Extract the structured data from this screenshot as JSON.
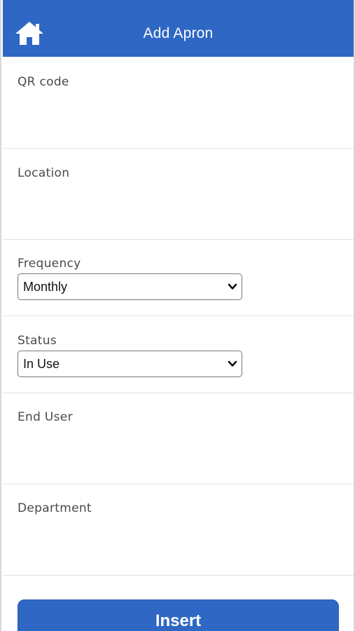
{
  "header": {
    "title": "Add Apron",
    "home_icon": "home-icon",
    "background": "#2f67c4"
  },
  "form": {
    "qr_code": {
      "label": "QR code",
      "value": ""
    },
    "location": {
      "label": "Location",
      "value": ""
    },
    "frequency": {
      "label": "Frequency",
      "selected": "Monthly"
    },
    "status": {
      "label": "Status",
      "selected": "In Use"
    },
    "end_user": {
      "label": "End User",
      "value": ""
    },
    "department": {
      "label": "Department",
      "value": ""
    }
  },
  "actions": {
    "insert_label": "Insert"
  }
}
